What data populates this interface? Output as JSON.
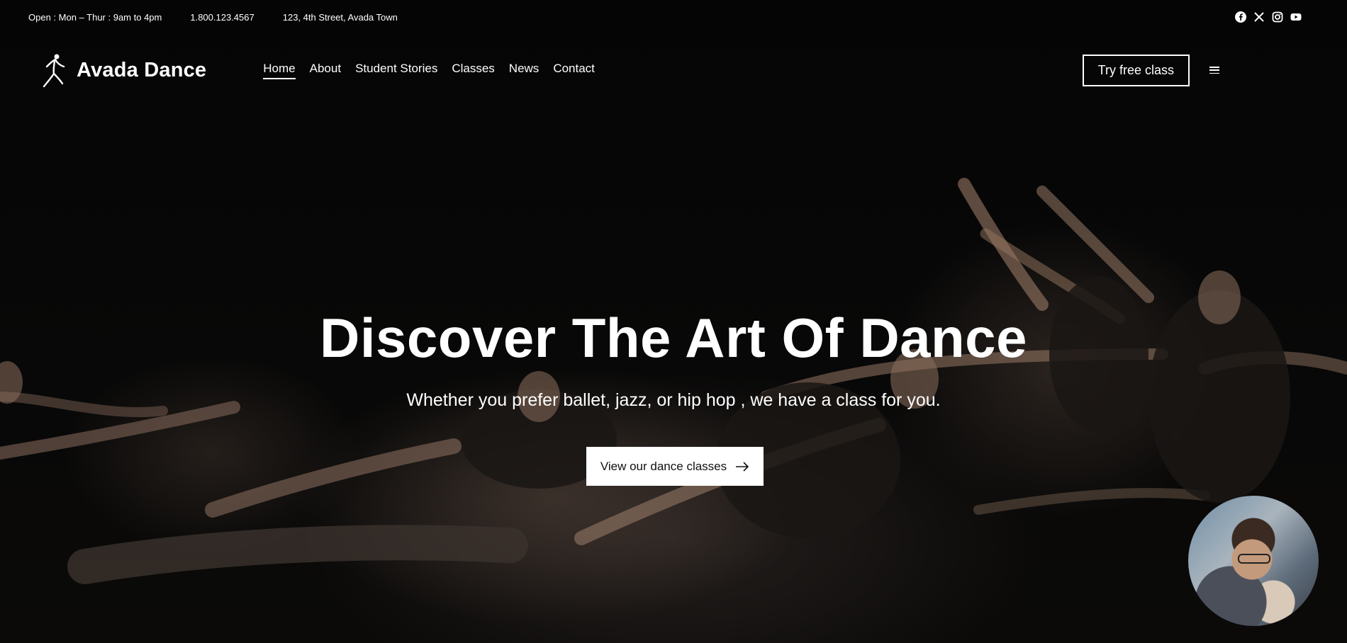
{
  "topbar": {
    "hours": "Open : Mon – Thur : 9am to 4pm",
    "phone": "1.800.123.4567",
    "address": "123, 4th Street, Avada Town",
    "socials": [
      "facebook-icon",
      "x-icon",
      "instagram-icon",
      "youtube-icon"
    ]
  },
  "header": {
    "brand": "Avada Dance",
    "nav": [
      {
        "label": "Home",
        "active": true
      },
      {
        "label": "About",
        "active": false
      },
      {
        "label": "Student Stories",
        "active": false
      },
      {
        "label": "Classes",
        "active": false
      },
      {
        "label": "News",
        "active": false
      },
      {
        "label": "Contact",
        "active": false
      }
    ],
    "cta_label": "Try free class",
    "menu_icon": "hamburger-menu-icon"
  },
  "hero": {
    "title": "Discover The Art Of Dance",
    "subtitle": "Whether you prefer ballet, jazz, or hip hop , we have a class for you.",
    "button_label": "View our dance classes",
    "button_icon": "arrow-right-icon"
  },
  "floating_video": {
    "icon": "video-avatar"
  },
  "colors": {
    "background": "#050505",
    "text": "#ffffff",
    "button_bg": "#ffffff",
    "button_text": "#111111"
  }
}
